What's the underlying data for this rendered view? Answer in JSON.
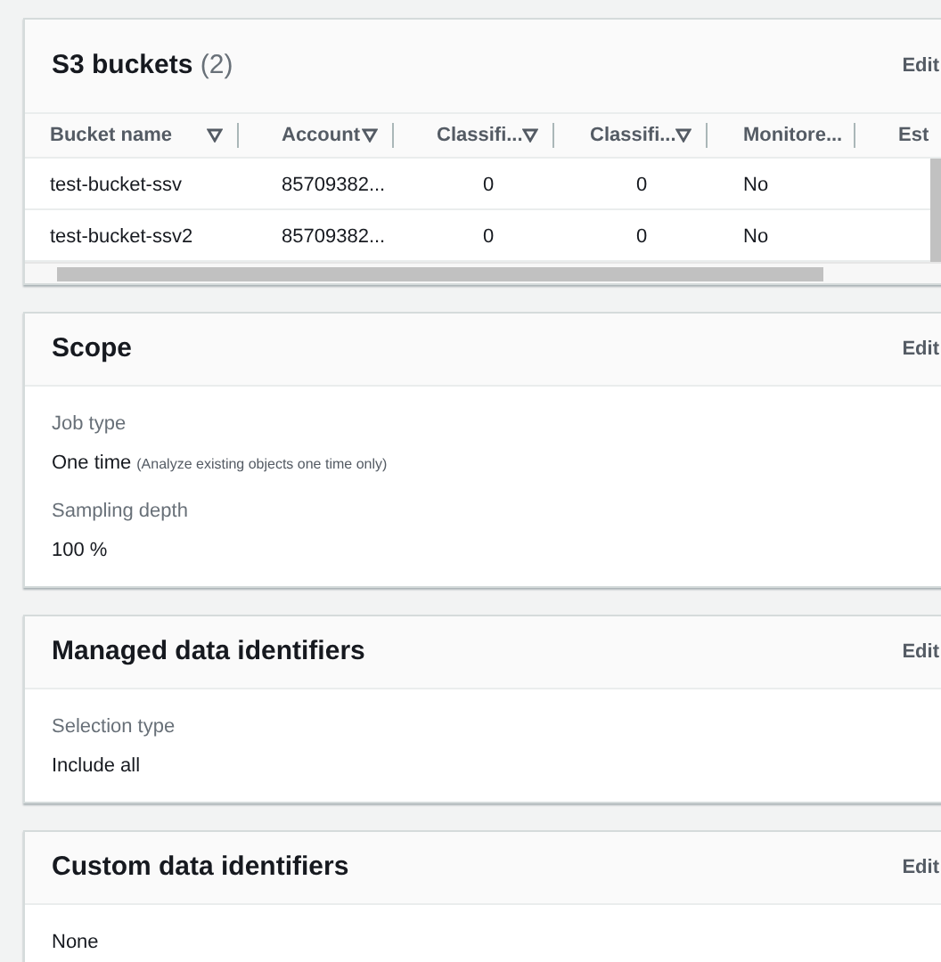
{
  "buckets_panel": {
    "title": "S3 buckets",
    "count": "(2)",
    "edit": "Edit",
    "columns": [
      {
        "label": "Bucket name",
        "sortable": true
      },
      {
        "label": "Account",
        "sortable": true
      },
      {
        "label": "Classifi...",
        "sortable": true
      },
      {
        "label": "Classifi...",
        "sortable": true
      },
      {
        "label": "Monitore...",
        "sortable": false
      },
      {
        "label": "Est",
        "sortable": false
      }
    ],
    "rows": [
      [
        "test-bucket-ssv",
        "85709382...",
        "0",
        "0",
        "No"
      ],
      [
        "test-bucket-ssv2",
        "85709382...",
        "0",
        "0",
        "No"
      ]
    ]
  },
  "sections": [
    {
      "title": "Scope",
      "edit": "Edit",
      "fields": [
        {
          "label": "Job type",
          "value": "One time",
          "note": "(Analyze existing objects one time only)"
        },
        {
          "label": "Sampling depth",
          "value": "100 %"
        }
      ]
    },
    {
      "title": "Managed data identifiers",
      "edit": "Edit",
      "fields": [
        {
          "label": "Selection type",
          "value": "Include all"
        }
      ]
    },
    {
      "title": "Custom data identifiers",
      "edit": "Edit",
      "fields": [
        {
          "value": "None"
        }
      ]
    }
  ]
}
